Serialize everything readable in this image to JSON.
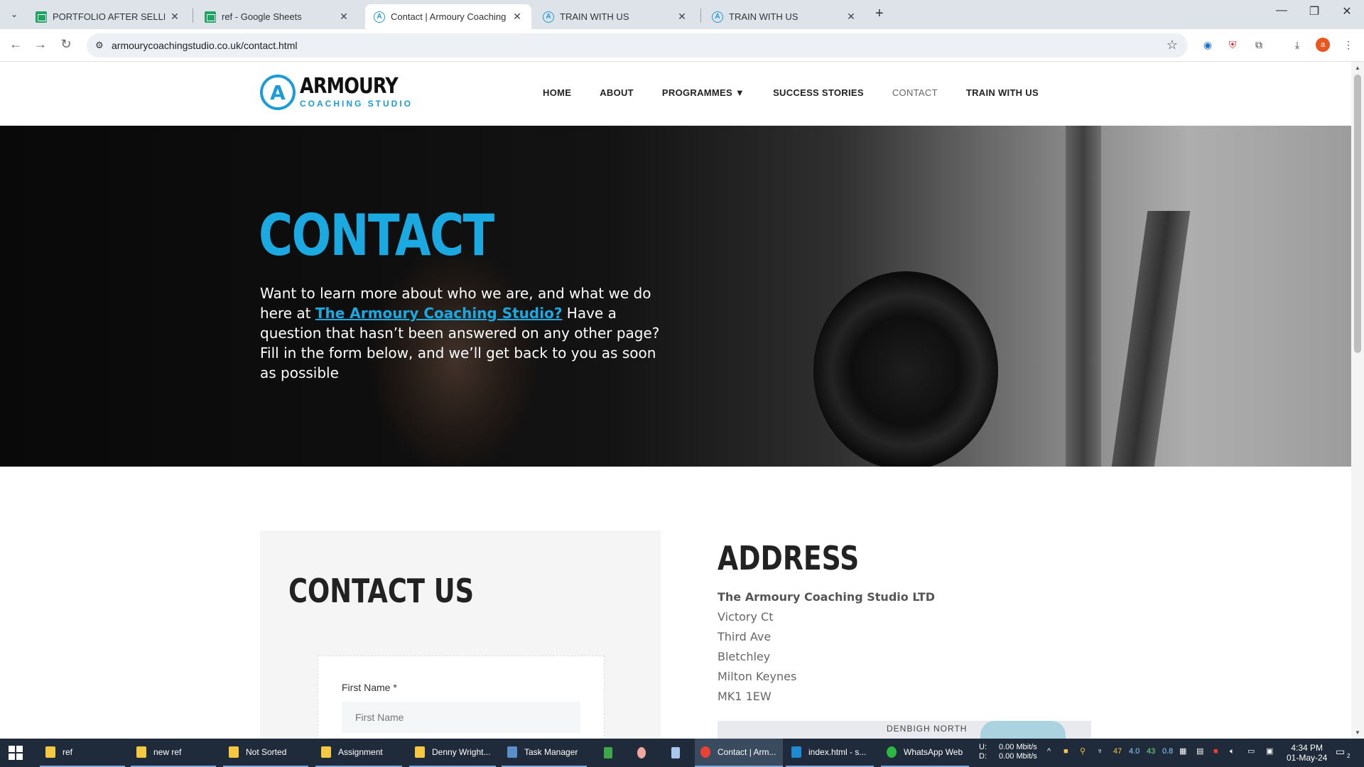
{
  "browser": {
    "tabs": [
      {
        "title": "PORTFOLIO AFTER SELLING - G",
        "favicon": "sheets-icon"
      },
      {
        "title": "ref - Google Sheets",
        "favicon": "sheets-icon"
      },
      {
        "title": "Contact | Armoury Coaching St",
        "favicon": "armoury-icon",
        "active": true
      },
      {
        "title": "TRAIN WITH US",
        "favicon": "armoury-icon"
      },
      {
        "title": "TRAIN WITH US",
        "favicon": "armoury-icon"
      }
    ],
    "url": "armourycoachingstudio.co.uk/contact.html",
    "new_tab": "+"
  },
  "site": {
    "logo": {
      "name": "ARMOURY",
      "subtitle": "COACHING STUDIO",
      "mark": "A"
    },
    "nav": [
      "HOME",
      "ABOUT",
      "PROGRAMMES ▼",
      "SUCCESS STORIES",
      "CONTACT",
      "TRAIN WITH US"
    ],
    "hero": {
      "title": "CONTACT",
      "text_before": "Want to learn more about who we are, and what we do here at ",
      "link": "The Armoury Coaching Studio?",
      "text_after": " Have a question that hasn’t been answered on any other page? Fill in the form below, and we’ll get back to you as soon as possible"
    },
    "contact_form": {
      "heading": "CONTACT US",
      "first_name_label": "First Name *",
      "first_name_placeholder": "First Name"
    },
    "address": {
      "heading": "ADDRESS",
      "company": "The Armoury Coaching Studio LTD",
      "lines": [
        "Victory Ct",
        "Third Ave",
        "Bletchley",
        "Milton Keynes",
        "MK1 1EW"
      ],
      "map_label": "DENBIGH NORTH"
    }
  },
  "taskbar": {
    "items": [
      {
        "label": "ref",
        "icon": "folder-icon"
      },
      {
        "label": "new ref",
        "icon": "folder-icon"
      },
      {
        "label": "Not Sorted",
        "icon": "folder-icon"
      },
      {
        "label": "Assignment",
        "icon": "folder-icon"
      },
      {
        "label": "Denny Wright...",
        "icon": "folder-icon"
      },
      {
        "label": "Task Manager",
        "icon": "task-manager-icon"
      },
      {
        "label": "Contact | Arm...",
        "icon": "chrome-icon",
        "active": true
      },
      {
        "label": "index.html - s...",
        "icon": "vscode-icon"
      },
      {
        "label": "WhatsApp Web",
        "icon": "whatsapp-icon"
      }
    ],
    "network": {
      "up_label": "U:",
      "down_label": "D:",
      "up": "0.00 Mbit/s",
      "down": "0.00 Mbit/s"
    },
    "tray_numbers": [
      "47",
      "4.0",
      "43",
      "0.8"
    ],
    "time": "4:34 PM",
    "date": "01-May-24",
    "notification_count": "2"
  }
}
